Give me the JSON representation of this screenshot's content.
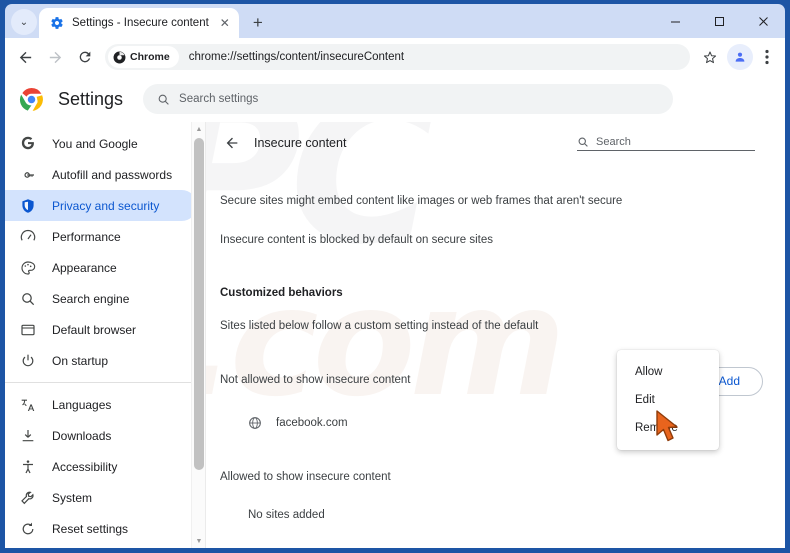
{
  "window": {
    "frame_color": "#1d55a5",
    "controls": [
      {
        "name": "minimize",
        "glyph": "—"
      },
      {
        "name": "maximize",
        "glyph": "□"
      },
      {
        "name": "close",
        "glyph": "✕"
      }
    ]
  },
  "tabstrip": {
    "tab_search_glyph": "⌄",
    "tabs": [
      {
        "title": "Settings - Insecure content",
        "favicon": "gear-icon",
        "close_glyph": "✕"
      }
    ],
    "new_tab_glyph": "+"
  },
  "toolbar": {
    "back_glyph": "←",
    "forward_glyph": "→",
    "reload_glyph": "↻",
    "chip_label": "Chrome",
    "url": "chrome://settings/content/insecureContent",
    "star_icon": "bookmark-star-icon",
    "profile_icon": "avatar-icon",
    "menu_glyph": "⋮"
  },
  "settings": {
    "title": "Settings",
    "search_placeholder": "Search settings",
    "logo": "chrome-logo"
  },
  "sidebar": {
    "groups": [
      {
        "items": [
          {
            "label": "You and Google",
            "icon": "google-g-icon",
            "active": false
          },
          {
            "label": "Autofill and passwords",
            "icon": "key-icon",
            "active": false
          },
          {
            "label": "Privacy and security",
            "icon": "shield-icon",
            "active": true
          },
          {
            "label": "Performance",
            "icon": "speedometer-icon",
            "active": false
          },
          {
            "label": "Appearance",
            "icon": "palette-icon",
            "active": false
          },
          {
            "label": "Search engine",
            "icon": "search-icon",
            "active": false
          },
          {
            "label": "Default browser",
            "icon": "browser-window-icon",
            "active": false
          },
          {
            "label": "On startup",
            "icon": "power-icon",
            "active": false
          }
        ]
      },
      {
        "items": [
          {
            "label": "Languages",
            "icon": "translate-icon",
            "active": false
          },
          {
            "label": "Downloads",
            "icon": "download-icon",
            "active": false
          },
          {
            "label": "Accessibility",
            "icon": "accessibility-icon",
            "active": false
          },
          {
            "label": "System",
            "icon": "wrench-icon",
            "active": false
          },
          {
            "label": "Reset settings",
            "icon": "restore-icon",
            "active": false
          }
        ]
      }
    ],
    "scrollbar": {
      "up_glyph": "▲",
      "down_glyph": "▼"
    }
  },
  "content": {
    "back_glyph": "←",
    "title": "Insecure content",
    "search_placeholder": "Search",
    "descriptions": [
      "Secure sites might embed content like images or web frames that aren't secure",
      "Insecure content is blocked by default on secure sites"
    ],
    "customized_section": {
      "heading": "Customized behaviors",
      "subtext": "Sites listed below follow a custom setting instead of the default"
    },
    "not_allowed": {
      "label": "Not allowed to show insecure content",
      "add_button": "Add",
      "sites": [
        {
          "name": "facebook.com",
          "icon": "globe-icon"
        }
      ]
    },
    "allowed": {
      "label": "Allowed to show insecure content",
      "empty_text": "No sites added"
    }
  },
  "context_menu": {
    "items": [
      {
        "label": "Allow"
      },
      {
        "label": "Edit"
      },
      {
        "label": "Remove"
      }
    ]
  },
  "cursor": {
    "color": "#e8641d",
    "name": "pointer-cursor"
  }
}
